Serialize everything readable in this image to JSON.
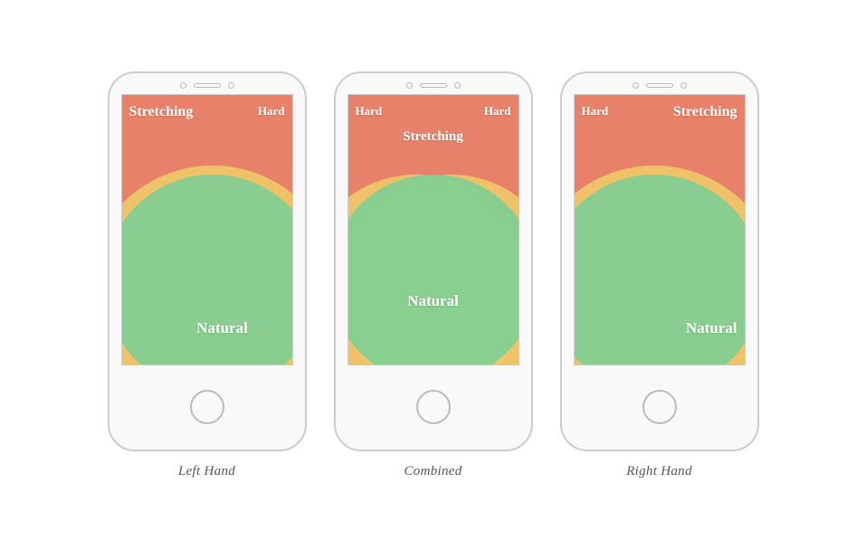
{
  "phones": [
    {
      "id": "left",
      "label": "Left Hand",
      "zones": {
        "hard": "Hard",
        "stretching": "Stretching",
        "natural": "Natural"
      }
    },
    {
      "id": "combined",
      "label": "Combined",
      "zones": {
        "hard_left": "Hard",
        "hard_right": "Hard",
        "stretching": "Stretching",
        "natural": "Natural"
      }
    },
    {
      "id": "right",
      "label": "Right Hand",
      "zones": {
        "hard": "Hard",
        "stretching": "Stretching",
        "natural": "Natural"
      }
    }
  ],
  "colors": {
    "hard": "#e07a60",
    "stretching": "#f0c870",
    "natural": "#7dcf95",
    "phone_border": "#cccccc",
    "label_text": "#666666"
  }
}
